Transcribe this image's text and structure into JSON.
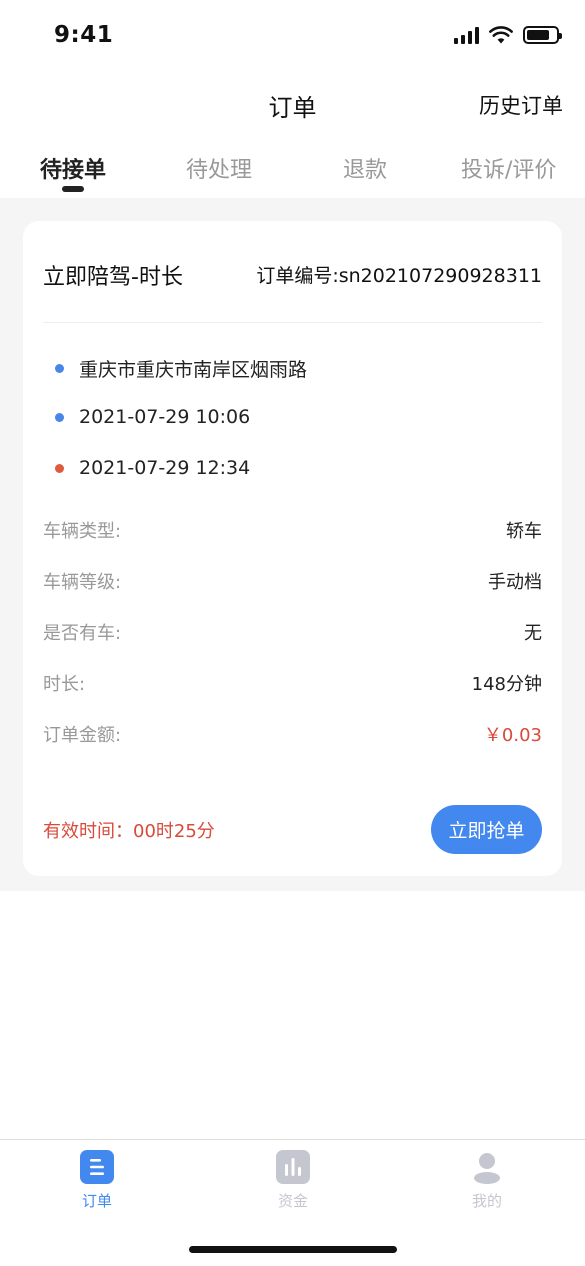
{
  "status_bar": {
    "time": "9:41"
  },
  "nav": {
    "title": "订单",
    "history_link": "历史订单"
  },
  "tabs": [
    {
      "label": "待接单",
      "active": true
    },
    {
      "label": "待处理",
      "active": false
    },
    {
      "label": "退款",
      "active": false
    },
    {
      "label": "投诉/评价",
      "active": false
    }
  ],
  "order": {
    "title": "立即陪驾-时长",
    "order_number": "订单编号:sn202107290928311",
    "info": [
      {
        "text": "重庆市重庆市南岸区烟雨路",
        "dot_color": "#4a86e8"
      },
      {
        "text": "2021-07-29 10:06",
        "dot_color": "#4a86e8"
      },
      {
        "text": "2021-07-29 12:34",
        "dot_color": "#e05a3c"
      }
    ],
    "details": [
      {
        "label": "车辆类型:",
        "value": "轿车"
      },
      {
        "label": "车辆等级:",
        "value": "手动档"
      },
      {
        "label": "是否有车:",
        "value": "无"
      },
      {
        "label": "时长:",
        "value": "148分钟"
      },
      {
        "label": "订单金额:",
        "value": "￥0.03"
      }
    ],
    "valid_time": "有效时间：00时25分",
    "grab_button": "立即抢单"
  },
  "tabbar": [
    {
      "label": "订单",
      "icon": "order-list-icon",
      "active": true
    },
    {
      "label": "资金",
      "icon": "bar-chart-icon",
      "active": false
    },
    {
      "label": "我的",
      "icon": "user-icon",
      "active": false
    }
  ],
  "colors": {
    "accent": "#4388ef",
    "price": "#d84a3a",
    "inactive_icon": "#c5c7d0"
  }
}
